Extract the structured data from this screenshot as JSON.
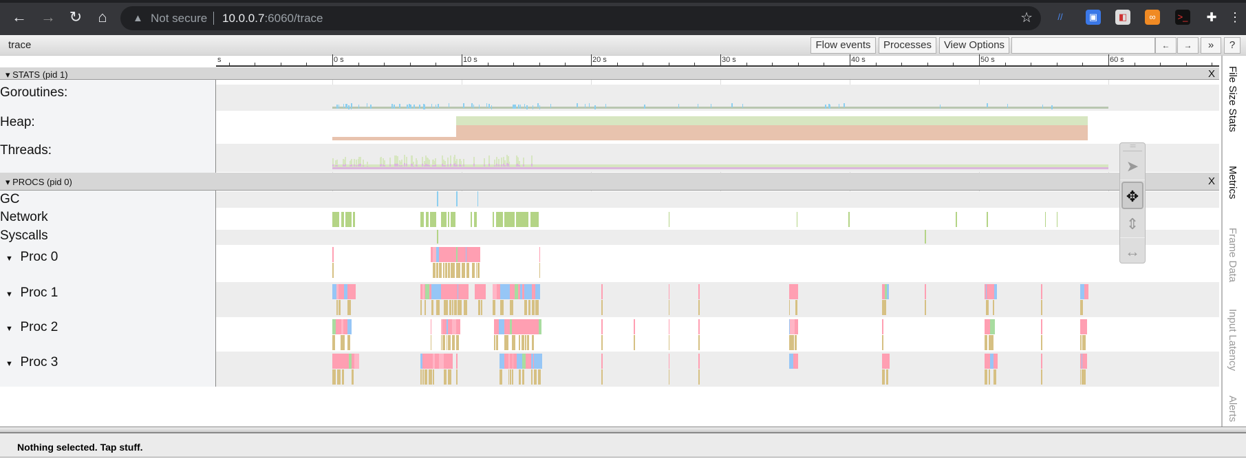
{
  "browser": {
    "security": "Not secure",
    "host": "10.0.0.7",
    "path": ":6060/trace"
  },
  "toolbar": {
    "title": "trace",
    "flow_events": "Flow events",
    "processes": "Processes",
    "view_options": "View Options",
    "search_placeholder": "",
    "prev": "←",
    "next": "→",
    "more": "»",
    "help": "?"
  },
  "ruler": {
    "unit_label": "s",
    "ticks": [
      "0 s",
      "10 s",
      "20 s",
      "30 s",
      "40 s",
      "50 s",
      "60 s"
    ]
  },
  "stats": {
    "header": "STATS (pid 1)",
    "close": "X",
    "tracks": [
      "Goroutines:",
      "Heap:",
      "Threads:"
    ]
  },
  "procs": {
    "header": "PROCS (pid 0)",
    "close": "X",
    "tracks": [
      "GC",
      "Network",
      "Syscalls"
    ],
    "procs": [
      "Proc 0",
      "Proc 1",
      "Proc 2",
      "Proc 3"
    ]
  },
  "side_tabs": [
    "File Size Stats",
    "Metrics",
    "Frame Data",
    "Input Latency",
    "Alerts"
  ],
  "status": "Nothing selected. Tap stuff.",
  "colors": {
    "network": "#b4d486",
    "pink": "#ff9fb2",
    "blue": "#96c6f6",
    "tan": "#d6c083",
    "heap_green": "#d7e6c1",
    "heap_orange": "#e8c3ae",
    "threads_purple": "#dcb6dd",
    "gc": "#8ccff0",
    "gor": "#b9c6b0"
  },
  "events": {
    "gc": [
      8.1,
      9.6,
      11.2
    ],
    "syscalls": [
      8.1,
      45.8
    ],
    "network": [
      [
        0,
        1.8
      ],
      [
        6.8,
        8.1
      ],
      [
        8.4,
        9.6
      ],
      [
        10.7,
        11.2
      ],
      [
        12.4,
        16.0
      ],
      [
        26.0,
        26.1
      ],
      [
        35.9,
        36.0
      ],
      [
        39.9,
        40.0
      ],
      [
        48.2,
        48.3
      ],
      [
        50.6,
        50.7
      ],
      [
        55.1,
        55.2
      ],
      [
        56.0,
        56.1
      ]
    ],
    "proc0": [
      [
        0,
        0.1
      ],
      [
        7.6,
        11.3
      ],
      [
        16.0,
        16.1
      ]
    ],
    "proc1": [
      [
        0,
        1.8
      ],
      [
        6.8,
        10.2
      ],
      [
        11.0,
        11.8
      ],
      [
        12.4,
        16.0
      ],
      [
        20.8,
        21.0
      ],
      [
        26.0,
        26.1
      ],
      [
        28.3,
        28.5
      ],
      [
        35.3,
        35.9
      ],
      [
        42.5,
        43.0
      ],
      [
        45.8,
        46.0
      ],
      [
        50.4,
        51.2
      ],
      [
        54.8,
        55.2
      ],
      [
        57.8,
        58.3
      ]
    ],
    "proc2": [
      [
        0,
        1.4
      ],
      [
        7.6,
        7.8
      ],
      [
        8.4,
        9.6
      ],
      [
        12.5,
        16.0
      ],
      [
        20.8,
        21.0
      ],
      [
        23.3,
        23.4
      ],
      [
        26.0,
        26.1
      ],
      [
        28.3,
        28.5
      ],
      [
        35.3,
        35.9
      ],
      [
        42.5,
        42.8
      ],
      [
        50.4,
        51.0
      ],
      [
        54.8,
        55.2
      ],
      [
        57.8,
        58.3
      ]
    ],
    "proc3": [
      [
        0,
        1.8
      ],
      [
        6.8,
        9.3
      ],
      [
        9.6,
        9.9
      ],
      [
        12.9,
        16.0
      ],
      [
        20.8,
        21.0
      ],
      [
        26.0,
        26.1
      ],
      [
        28.3,
        28.5
      ],
      [
        35.3,
        35.9
      ],
      [
        42.5,
        43.0
      ],
      [
        50.4,
        51.2
      ],
      [
        54.8,
        55.2
      ],
      [
        57.8,
        58.3
      ]
    ],
    "heap": {
      "low_end": 9.6,
      "end": 58.4
    },
    "threads_active": [
      0,
      16.0
    ],
    "trace_end": 60
  }
}
